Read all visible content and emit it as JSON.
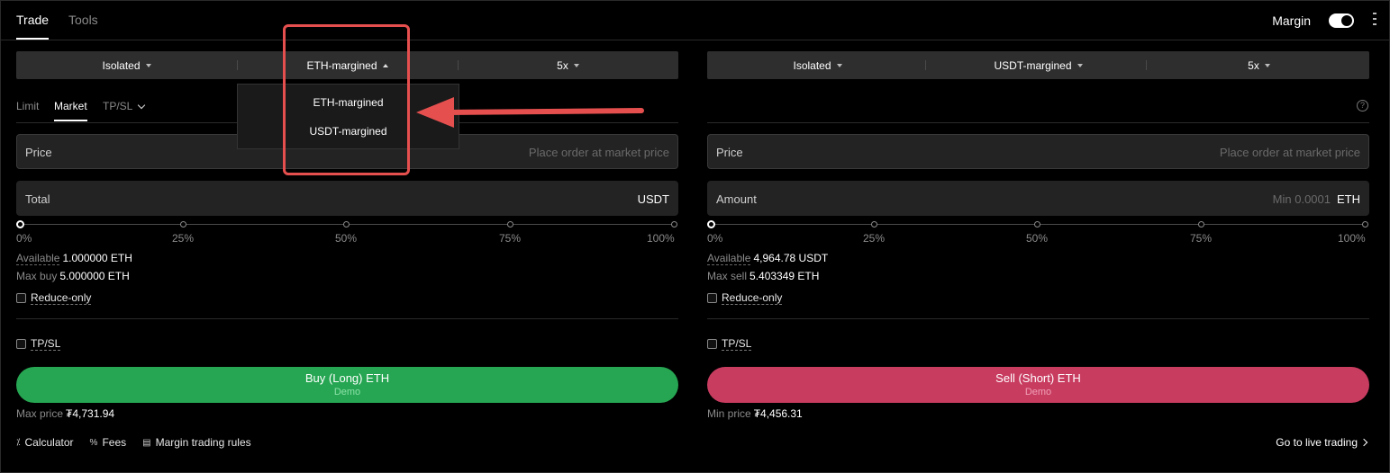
{
  "header": {
    "tabs": [
      "Trade",
      "Tools"
    ],
    "margin_label": "Margin"
  },
  "buy_panel": {
    "selectors": [
      "Isolated",
      "ETH-margined",
      "5x"
    ],
    "order_tabs": [
      "Limit",
      "Market",
      "TP/SL"
    ],
    "price_label": "Price",
    "price_placeholder": "Place order at market price",
    "total_label": "Total",
    "total_unit": "USDT",
    "slider_ticks": [
      "0%",
      "25%",
      "50%",
      "75%",
      "100%"
    ],
    "available_label": "Available",
    "available_value": "1.000000 ETH",
    "max_label": "Max buy",
    "max_value": "5.000000 ETH",
    "reduce_only": "Reduce-only",
    "tpsl": "TP/SL",
    "button_label": "Buy (Long) ETH",
    "button_sub": "Demo",
    "price_note_label": "Max price",
    "price_note_value": "₮4,731.94"
  },
  "sell_panel": {
    "selectors": [
      "Isolated",
      "USDT-margined",
      "5x"
    ],
    "price_label": "Price",
    "price_placeholder": "Place order at market price",
    "amount_label": "Amount",
    "amount_placeholder": "Min 0.0001",
    "amount_unit": "ETH",
    "slider_ticks": [
      "0%",
      "25%",
      "50%",
      "75%",
      "100%"
    ],
    "available_label": "Available",
    "available_value": "4,964.78 USDT",
    "max_label": "Max sell",
    "max_value": "5.403349 ETH",
    "reduce_only": "Reduce-only",
    "tpsl": "TP/SL",
    "button_label": "Sell (Short) ETH",
    "button_sub": "Demo",
    "price_note_label": "Min price",
    "price_note_value": "₮4,456.31"
  },
  "dropdown": {
    "options": [
      "ETH-margined",
      "USDT-margined"
    ]
  },
  "footer": {
    "links": [
      "Calculator",
      "Fees",
      "Margin trading rules"
    ],
    "live_link": "Go to live trading"
  },
  "colors": {
    "buy": "#26a652",
    "sell": "#c83c60",
    "annotation": "#e5504f"
  },
  "slider_level": {
    "buy": 0,
    "sell": 0
  }
}
